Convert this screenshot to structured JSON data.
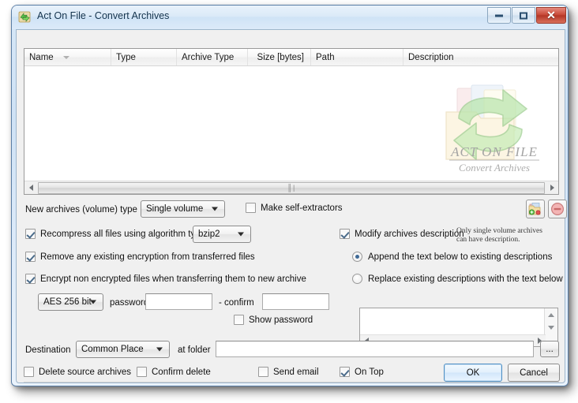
{
  "window": {
    "title": "Act On File - Convert Archives",
    "app_icon": "recycle-arrows-icon",
    "minimize_label": "Minimize",
    "maximize_label": "Maximize",
    "close_label": "Close"
  },
  "file_list": {
    "columns": [
      {
        "label": "Name",
        "sorted": true
      },
      {
        "label": "Type",
        "sorted": false
      },
      {
        "label": "Archive Type",
        "sorted": false
      },
      {
        "label": "Size [bytes]",
        "sorted": false
      },
      {
        "label": "Path",
        "sorted": false
      },
      {
        "label": "Description",
        "sorted": false
      }
    ],
    "rows": [],
    "watermark_line1": "ACT ON FILE",
    "watermark_line2": "Convert Archives"
  },
  "toolbar": {
    "add_button_label": "Add archives",
    "remove_button_label": "Remove archives"
  },
  "volume_row": {
    "label": "New archives (volume) type",
    "combo_value": "Single volume",
    "self_extractor_label": "Make self-extractors",
    "self_extractor_checked": false
  },
  "options": {
    "recompress_label": "Recompress all files using algorithm type",
    "recompress_checked": true,
    "algorithm_value": "bzip2",
    "remove_encryption_label": "Remove any existing encryption from transferred files",
    "remove_encryption_checked": true,
    "encrypt_label": "Encrypt non encrypted files when transferring them to new archive",
    "encrypt_checked": true,
    "cipher_value": "AES 256 bit",
    "password_label": "password",
    "password_value": "",
    "confirm_label": "- confirm",
    "confirm_value": "",
    "show_password_label": "Show password",
    "show_password_checked": false
  },
  "description": {
    "modify_label": "Modify archives description",
    "modify_checked": true,
    "hint_line1": "Only single volume archives",
    "hint_line2": "can have description.",
    "append_label": "Append the text below to existing descriptions",
    "replace_label": "Replace existing descriptions with the text below",
    "selected_mode": "append",
    "text_value": ""
  },
  "destination": {
    "label": "Destination",
    "combo_value": "Common Place",
    "at_folder_label": "at folder",
    "folder_value": "",
    "browse_label": "..."
  },
  "footer": {
    "delete_source_label": "Delete source archives",
    "delete_source_checked": false,
    "confirm_delete_label": "Confirm delete",
    "confirm_delete_checked": false,
    "send_email_label": "Send email",
    "send_email_checked": false,
    "on_top_label": "On Top",
    "on_top_checked": true,
    "ok_label": "OK",
    "cancel_label": "Cancel"
  },
  "colors": {
    "accent": "#4f8fc4",
    "title_text": "#13334d",
    "close_button": "#b43626",
    "dialog_bg": "#f0f0f0"
  }
}
